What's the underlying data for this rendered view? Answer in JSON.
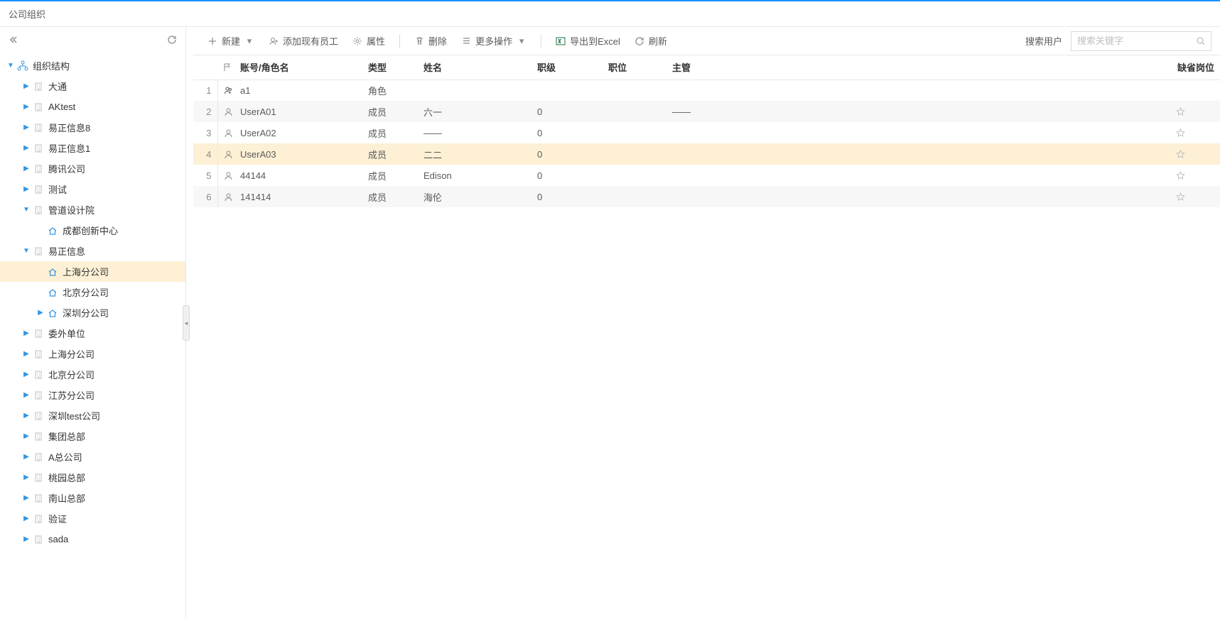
{
  "header": {
    "title": "公司组织"
  },
  "tree": {
    "root": {
      "label": "组织结构"
    },
    "items": [
      {
        "label": "大通",
        "level": 1,
        "type": "building",
        "expand": "closed"
      },
      {
        "label": "AKtest",
        "level": 1,
        "type": "building",
        "expand": "closed"
      },
      {
        "label": "易正信息8",
        "level": 1,
        "type": "building",
        "expand": "closed"
      },
      {
        "label": "易正信息1",
        "level": 1,
        "type": "building",
        "expand": "closed"
      },
      {
        "label": "腾讯公司",
        "level": 1,
        "type": "building",
        "expand": "closed"
      },
      {
        "label": "测试",
        "level": 1,
        "type": "building",
        "expand": "closed"
      },
      {
        "label": "管道设计院",
        "level": 1,
        "type": "building",
        "expand": "open"
      },
      {
        "label": "成都创新中心",
        "level": 2,
        "type": "home",
        "expand": "none"
      },
      {
        "label": "易正信息",
        "level": 1,
        "type": "building",
        "expand": "open"
      },
      {
        "label": "上海分公司",
        "level": 2,
        "type": "home",
        "expand": "none",
        "selected": true
      },
      {
        "label": "北京分公司",
        "level": 2,
        "type": "home",
        "expand": "none"
      },
      {
        "label": "深圳分公司",
        "level": 2,
        "type": "home",
        "expand": "closed"
      },
      {
        "label": "委外单位",
        "level": 1,
        "type": "building",
        "expand": "closed"
      },
      {
        "label": "上海分公司",
        "level": 1,
        "type": "building",
        "expand": "closed"
      },
      {
        "label": "北京分公司",
        "level": 1,
        "type": "building",
        "expand": "closed"
      },
      {
        "label": "江苏分公司",
        "level": 1,
        "type": "building",
        "expand": "closed"
      },
      {
        "label": "深圳test公司",
        "level": 1,
        "type": "building",
        "expand": "closed"
      },
      {
        "label": "集团总部",
        "level": 1,
        "type": "building",
        "expand": "closed"
      },
      {
        "label": "A总公司",
        "level": 1,
        "type": "building",
        "expand": "closed"
      },
      {
        "label": "桃园总部",
        "level": 1,
        "type": "building",
        "expand": "closed"
      },
      {
        "label": "南山总部",
        "level": 1,
        "type": "building",
        "expand": "closed"
      },
      {
        "label": "验证",
        "level": 1,
        "type": "building",
        "expand": "closed"
      },
      {
        "label": "sada",
        "level": 1,
        "type": "building",
        "expand": "closed"
      }
    ]
  },
  "toolbar": {
    "new": "新建",
    "add_existing": "添加现有员工",
    "properties": "属性",
    "delete": "删除",
    "more": "更多操作",
    "export": "导出到Excel",
    "refresh": "刷新",
    "search_label": "搜索用户",
    "search_placeholder": "搜索关键字"
  },
  "table": {
    "headers": {
      "account": "账号/角色名",
      "type": "类型",
      "name": "姓名",
      "rank": "职级",
      "position": "职位",
      "supervisor": "主管",
      "default_post": "缺省岗位"
    },
    "rows": [
      {
        "num": "1",
        "icon": "role",
        "account": "a1",
        "type": "角色",
        "name": "",
        "rank": "",
        "position": "",
        "supervisor": "",
        "star": false
      },
      {
        "num": "2",
        "icon": "user",
        "account": "UserA01",
        "type": "成员",
        "name": "六一",
        "rank": "0",
        "position": "",
        "supervisor": "——",
        "star": true,
        "even": true
      },
      {
        "num": "3",
        "icon": "user",
        "account": "UserA02",
        "type": "成员",
        "name": "——",
        "rank": "0",
        "position": "",
        "supervisor": "",
        "star": true
      },
      {
        "num": "4",
        "icon": "user",
        "account": "UserA03",
        "type": "成员",
        "name": "二二",
        "rank": "0",
        "position": "",
        "supervisor": "",
        "star": true,
        "highlighted": true
      },
      {
        "num": "5",
        "icon": "user",
        "account": "44144",
        "type": "成员",
        "name": "Edison",
        "rank": "0",
        "position": "",
        "supervisor": "",
        "star": true
      },
      {
        "num": "6",
        "icon": "user",
        "account": "141414",
        "type": "成员",
        "name": "海伦",
        "rank": "0",
        "position": "",
        "supervisor": "",
        "star": true,
        "even": true
      }
    ]
  }
}
